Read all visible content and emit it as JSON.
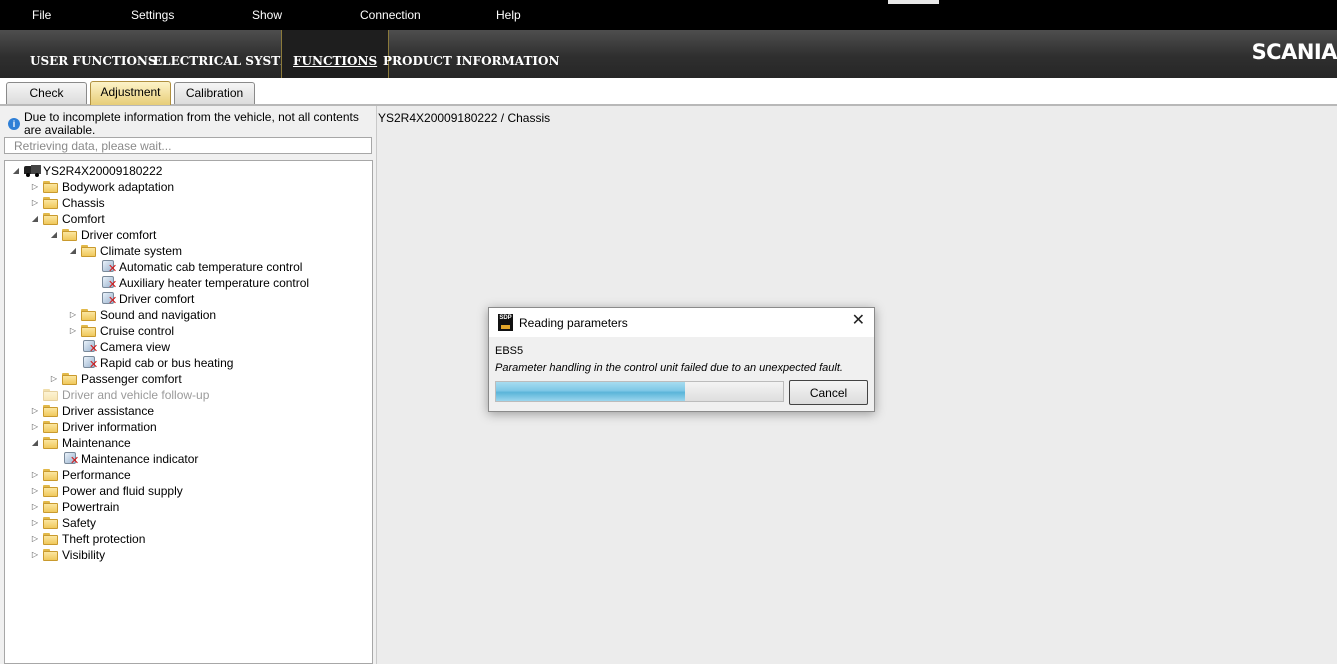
{
  "menu": [
    "File",
    "Settings",
    "Show",
    "Connection",
    "Help"
  ],
  "nav": [
    "USER FUNCTIONS",
    "ELECTRICAL SYSTEM",
    "FUNCTIONS",
    "PRODUCT INFORMATION"
  ],
  "nav_active": "FUNCTIONS",
  "brand": "SCANIA",
  "tabs": [
    "Check",
    "Adjustment",
    "Calibration"
  ],
  "tab_selected": "Adjustment",
  "left": {
    "info": "Due to incomplete information from the vehicle, not all contents are available.",
    "search_placeholder": "Retrieving data, please wait...",
    "tree": [
      {
        "label": "YS2R4X20009180222",
        "level": 0,
        "icon": "truck-icon",
        "state": "expanded"
      },
      {
        "label": "Bodywork adaptation",
        "level": 1,
        "icon": "folder-icon",
        "state": "collapsed"
      },
      {
        "label": "Chassis",
        "level": 1,
        "icon": "folder-icon",
        "state": "collapsed"
      },
      {
        "label": "Comfort",
        "level": 1,
        "icon": "folder-icon",
        "state": "expanded"
      },
      {
        "label": "Driver comfort",
        "level": 2,
        "icon": "folder-icon",
        "state": "expanded"
      },
      {
        "label": "Climate system",
        "level": 3,
        "icon": "folder-icon",
        "state": "expanded"
      },
      {
        "label": "Automatic cab temperature control",
        "level": 4,
        "icon": "parameter-unavailable-icon",
        "state": "leaf"
      },
      {
        "label": "Auxiliary heater temperature control",
        "level": 4,
        "icon": "parameter-unavailable-icon",
        "state": "leaf"
      },
      {
        "label": "Driver comfort",
        "level": 4,
        "icon": "parameter-unavailable-icon",
        "state": "leaf"
      },
      {
        "label": "Sound and navigation",
        "level": 3,
        "icon": "folder-icon",
        "state": "collapsed"
      },
      {
        "label": "Cruise control",
        "level": 3,
        "icon": "folder-icon",
        "state": "collapsed"
      },
      {
        "label": "Camera view",
        "level": 3,
        "icon": "parameter-unavailable-icon",
        "state": "leaf"
      },
      {
        "label": "Rapid cab or bus heating",
        "level": 3,
        "icon": "parameter-unavailable-icon",
        "state": "leaf"
      },
      {
        "label": "Passenger comfort",
        "level": 2,
        "icon": "folder-icon",
        "state": "collapsed"
      },
      {
        "label": "Driver and vehicle follow-up",
        "level": 1,
        "icon": "folder-icon",
        "state": "disabled"
      },
      {
        "label": "Driver assistance",
        "level": 1,
        "icon": "folder-icon",
        "state": "collapsed"
      },
      {
        "label": "Driver information",
        "level": 1,
        "icon": "folder-icon",
        "state": "collapsed"
      },
      {
        "label": "Maintenance",
        "level": 1,
        "icon": "folder-icon",
        "state": "expanded"
      },
      {
        "label": "Maintenance indicator",
        "level": 2,
        "icon": "parameter-unavailable-icon",
        "state": "leaf"
      },
      {
        "label": "Performance",
        "level": 1,
        "icon": "folder-icon",
        "state": "collapsed"
      },
      {
        "label": "Power and fluid supply",
        "level": 1,
        "icon": "folder-icon",
        "state": "collapsed"
      },
      {
        "label": "Powertrain",
        "level": 1,
        "icon": "folder-icon",
        "state": "collapsed"
      },
      {
        "label": "Safety",
        "level": 1,
        "icon": "folder-icon",
        "state": "collapsed"
      },
      {
        "label": "Theft protection",
        "level": 1,
        "icon": "folder-icon",
        "state": "collapsed"
      },
      {
        "label": "Visibility",
        "level": 1,
        "icon": "folder-icon",
        "state": "collapsed"
      }
    ]
  },
  "right": {
    "breadcrumb": "YS2R4X20009180222 / Chassis"
  },
  "dialog": {
    "app_icon_text": "SDP",
    "title": "Reading parameters",
    "ecu": "EBS5",
    "message": "Parameter handling in the control unit failed due to an unexpected fault.",
    "progress": 0.66,
    "cancel_label": "Cancel"
  },
  "colors": {
    "menubar": "#000000",
    "nav_gradient_top": "#4e4e4e",
    "tab_selected": "#e7cd78",
    "progress_fill": "#7fc8e6",
    "error_x": "#d21a1a",
    "folder": "#f0c85c"
  }
}
